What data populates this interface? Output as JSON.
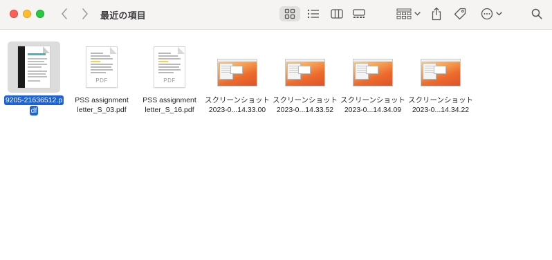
{
  "window": {
    "title": "最近の項目"
  },
  "toolbar": {
    "buttons": [
      {
        "name": "back",
        "icon": "chevron-left-icon"
      },
      {
        "name": "forward",
        "icon": "chevron-right-icon"
      },
      {
        "name": "view-icons",
        "icon": "grid-icon",
        "selected": true
      },
      {
        "name": "view-list",
        "icon": "list-icon"
      },
      {
        "name": "view-columns",
        "icon": "columns-icon"
      },
      {
        "name": "view-gallery",
        "icon": "gallery-icon"
      },
      {
        "name": "group",
        "icon": "group-grid-icon"
      },
      {
        "name": "share",
        "icon": "share-icon"
      },
      {
        "name": "tags",
        "icon": "tag-icon"
      },
      {
        "name": "more",
        "icon": "ellipsis-circle-icon"
      },
      {
        "name": "search",
        "icon": "search-icon"
      }
    ]
  },
  "colors": {
    "selection": "#1f62d6",
    "traffic_close": "#fe5f57",
    "traffic_min": "#febc2e",
    "traffic_max": "#28c840"
  },
  "files": [
    {
      "line1": "9205-21636512.p",
      "line2": "df",
      "kind": "scan-pdf",
      "selected": true
    },
    {
      "line1": "PSS assignment",
      "line2": "letter_S_03.pdf",
      "kind": "pdf",
      "thumb_label": "PDF"
    },
    {
      "line1": "PSS assignment",
      "line2": "letter_S_16.pdf",
      "kind": "pdf",
      "thumb_label": "PDF"
    },
    {
      "line1": "スクリーンショット",
      "line2": "2023-0...14.33.00",
      "kind": "screenshot"
    },
    {
      "line1": "スクリーンショット",
      "line2": "2023-0...14.33.52",
      "kind": "screenshot"
    },
    {
      "line1": "スクリーンショット",
      "line2": "2023-0...14.34.09",
      "kind": "screenshot"
    },
    {
      "line1": "スクリーンショット",
      "line2": "2023-0...14.34.22",
      "kind": "screenshot"
    }
  ]
}
